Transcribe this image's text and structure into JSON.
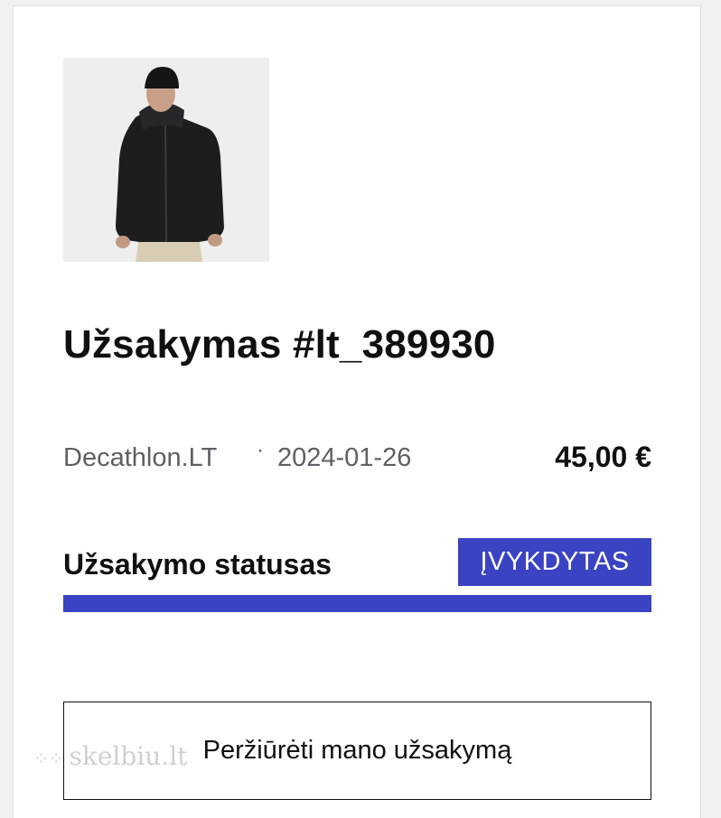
{
  "order": {
    "title": "Užsakymas #lt_389930",
    "seller": "Decathlon.LT",
    "separator": "·",
    "date": "2024-01-26",
    "total": "45,00 €",
    "status_label": "Užsakymo statusas",
    "status_badge": "ĮVYKDYTAS",
    "progress": 1.0,
    "view_button_label": "Peržiūrėti mano užsakymą"
  },
  "product_image": {
    "icon": "product-photo-jacket"
  },
  "watermark": {
    "text": "skelbiu.lt"
  },
  "colors": {
    "accent": "#3a43c2",
    "text": "#101010",
    "muted": "#5f5f66"
  }
}
